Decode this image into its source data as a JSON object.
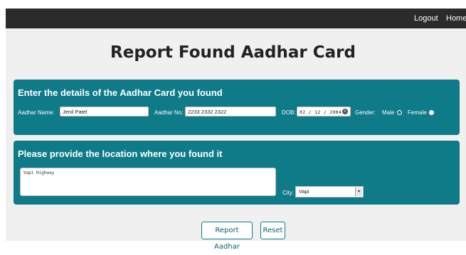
{
  "nav": {
    "logout": "Logout",
    "home": "Home"
  },
  "page_title": "Report Found Aadhar Card",
  "details_panel": {
    "heading": "Enter the details of the Aadhar Card you found",
    "name_label": "Aadhar Name:",
    "name_value": "Jenil Patel",
    "number_label": "Aadhar No:",
    "number_value": "2233 2332 2322",
    "dob_label": "DOB:",
    "dob_value": "02 / 12 / 2004",
    "gender_label": "Gender:",
    "gender_options": [
      "Male",
      "Female"
    ],
    "gender_selected": "Female"
  },
  "location_panel": {
    "heading": "Please provide the location where you found it",
    "location_value": "Vapi Highway",
    "city_label": "City:",
    "city_value": "Vapi"
  },
  "buttons": {
    "report": "Report Aadhar",
    "reset": "Reset"
  },
  "colors": {
    "panel": "#0f7a88",
    "topbar": "#2b2b2b",
    "background": "#f0f0f0"
  }
}
